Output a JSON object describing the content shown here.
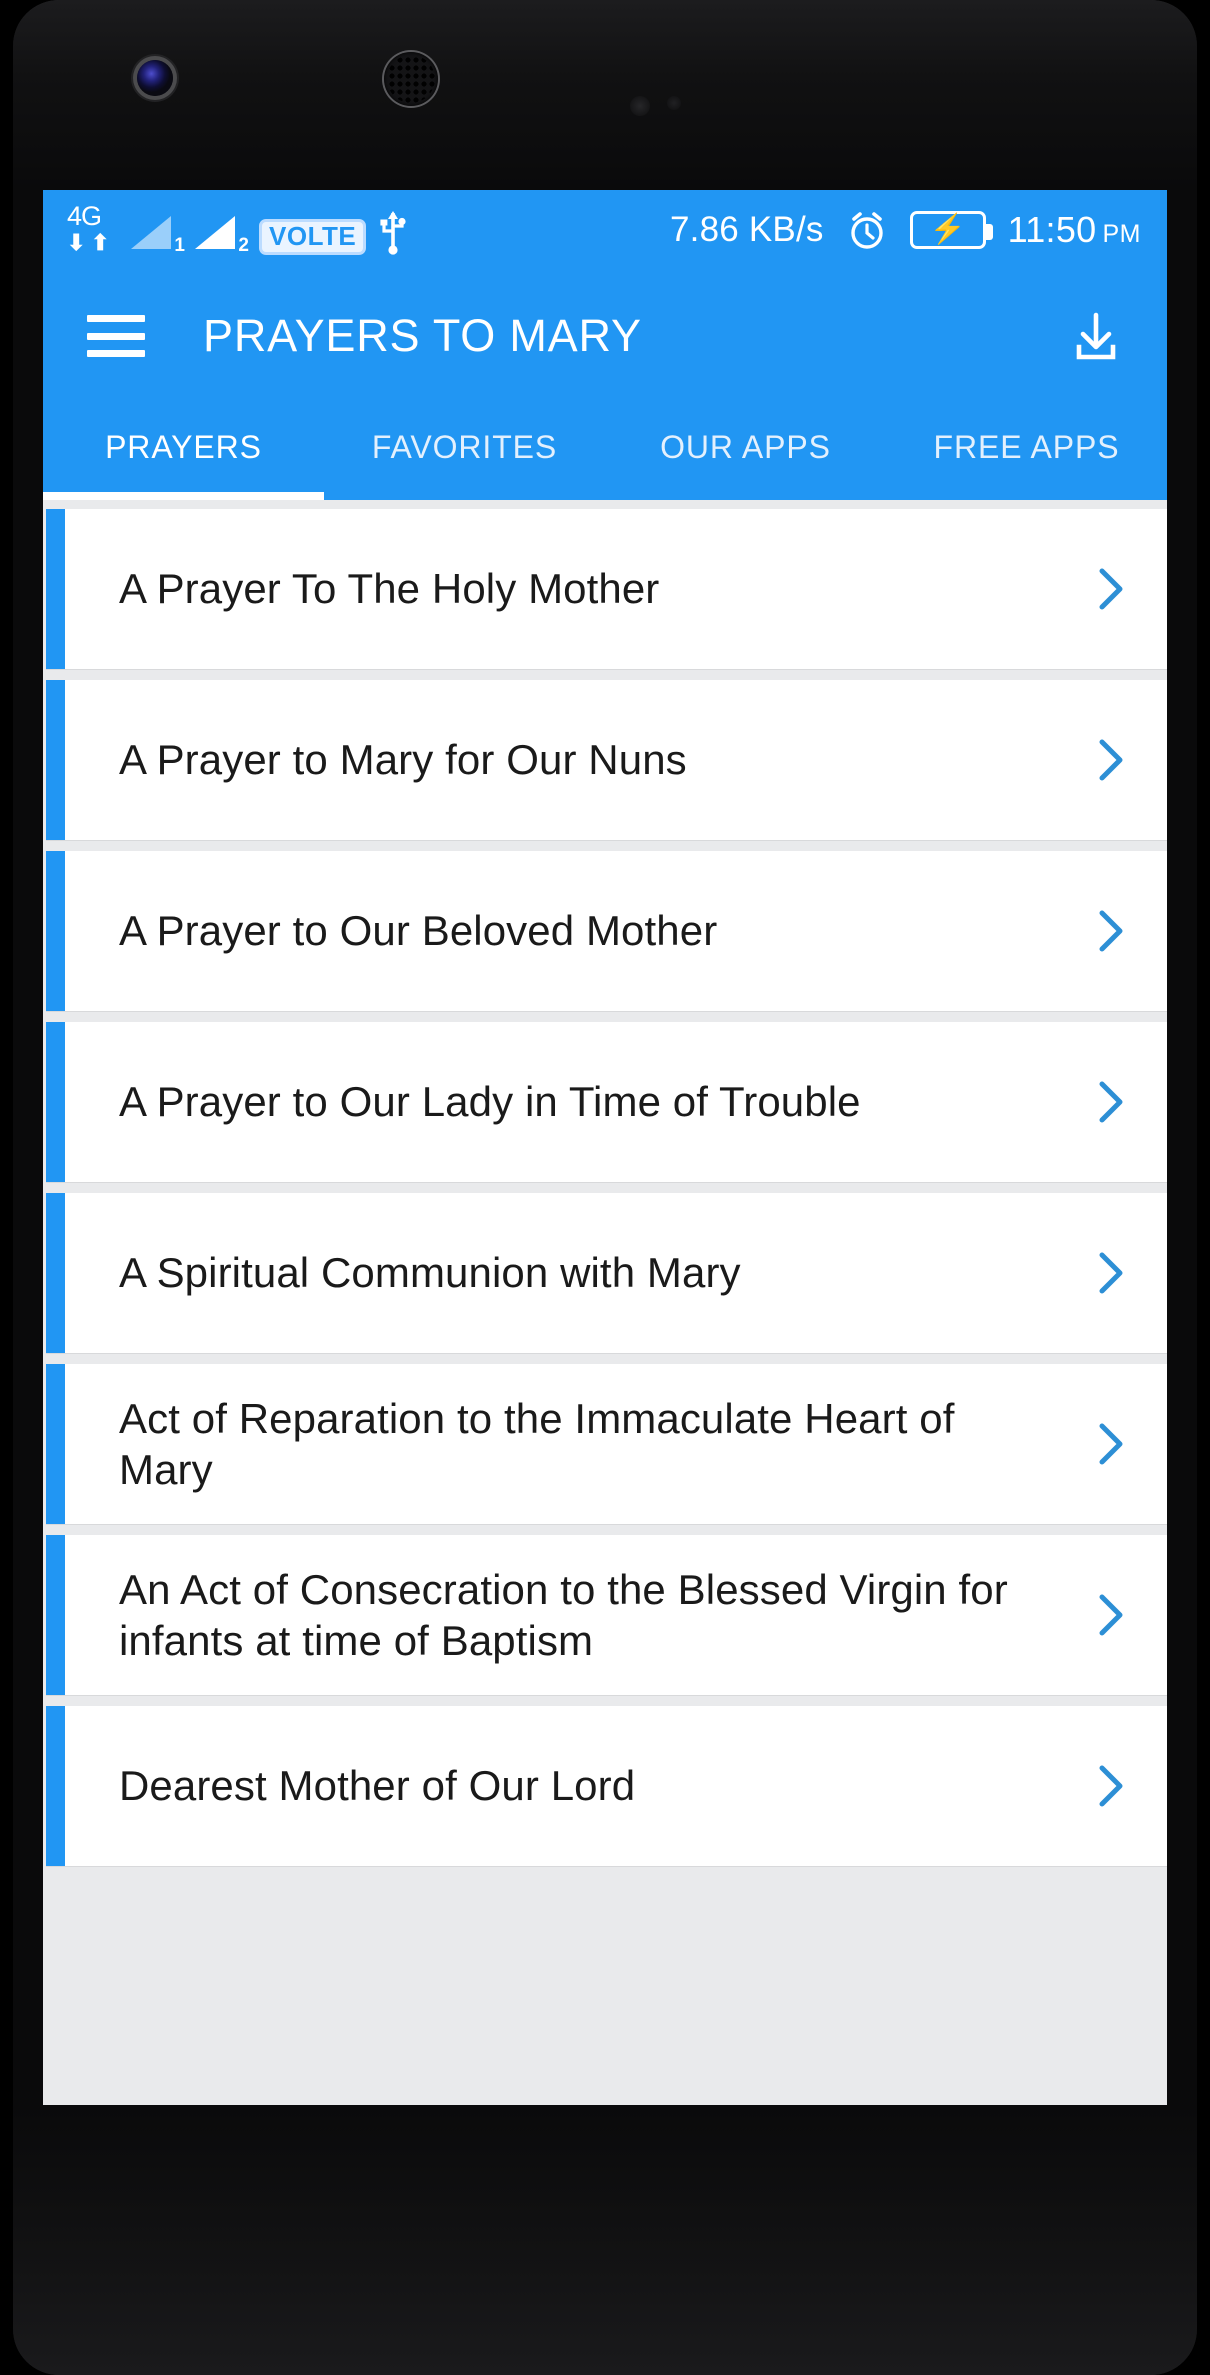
{
  "status_bar": {
    "network_type": "4G",
    "sim1_label": "1",
    "sim2_label": "2",
    "volte_label": "VOLTE",
    "usb_icon": "usb-icon",
    "net_speed": "7.86 KB/s",
    "alarm_icon": "alarm-clock-icon",
    "battery_icon": "battery-charging-icon",
    "time": "11:50",
    "ampm": "PM"
  },
  "app_bar": {
    "menu_icon": "hamburger-menu-icon",
    "title": "PRAYERS TO MARY",
    "download_icon": "download-icon"
  },
  "tabs": [
    {
      "label": "PRAYERS",
      "active": true
    },
    {
      "label": "FAVORITES",
      "active": false
    },
    {
      "label": "OUR APPS",
      "active": false
    },
    {
      "label": "FREE APPS",
      "active": false
    }
  ],
  "prayers": [
    {
      "title": "A Prayer To The Holy Mother"
    },
    {
      "title": "A Prayer to Mary for Our Nuns"
    },
    {
      "title": "A Prayer to Our Beloved Mother"
    },
    {
      "title": "A Prayer to Our Lady in Time of Trouble"
    },
    {
      "title": "A Spiritual Communion with Mary"
    },
    {
      "title": "Act of Reparation to the Immaculate Heart of Mary"
    },
    {
      "title": "An Act of Consecration to the Blessed Virgin for infants at time of Baptism"
    },
    {
      "title": "Dearest Mother of Our Lord"
    }
  ],
  "colors": {
    "primary": "#2196f3",
    "accent_bar": "#2196f3",
    "chevron": "#2196f3",
    "card_bg": "#ffffff",
    "list_bg": "#e9eaec",
    "title_text": "#1a1a1a"
  }
}
